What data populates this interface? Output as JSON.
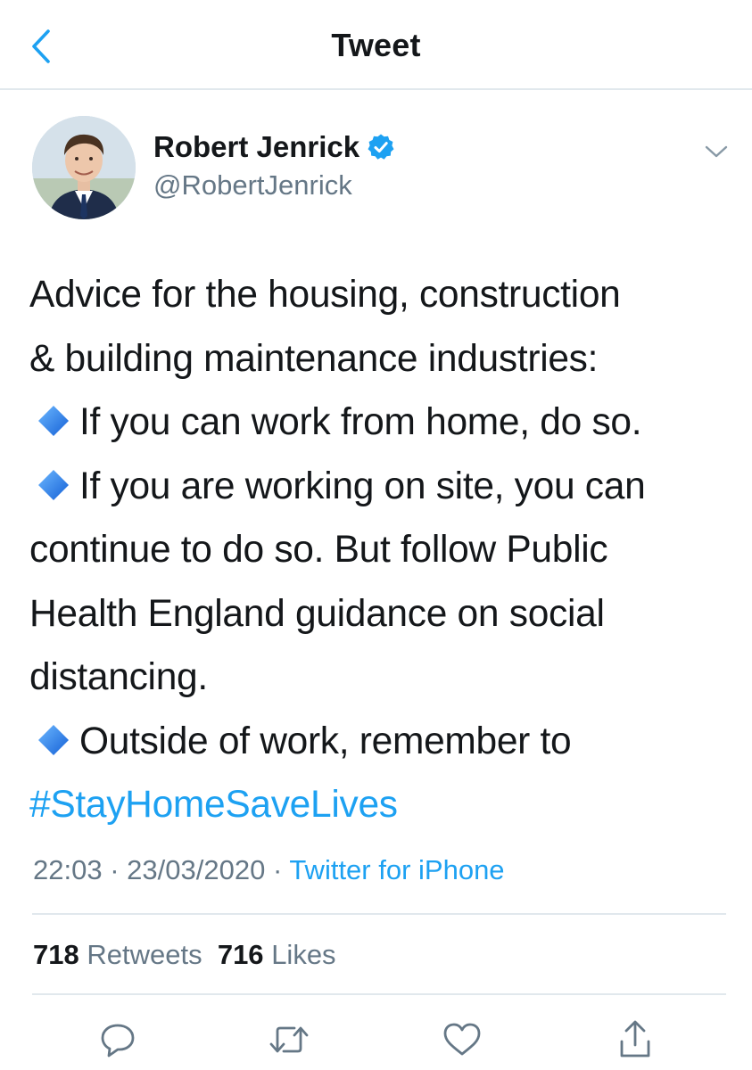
{
  "header": {
    "title": "Tweet",
    "back_icon": "chevron-left-icon"
  },
  "author": {
    "name": "Robert Jenrick",
    "handle": "@RobertJenrick",
    "verified": true,
    "more_icon": "chevron-down-icon"
  },
  "tweet": {
    "lines": [
      "Advice for the housing, construction",
      "& building maintenance industries:",
      "If you can work from home, do so.",
      "If you are working on site, you can",
      "continue to do so. But follow Public",
      "Health England guidance on social",
      "distancing.",
      "Outside of work, remember to"
    ],
    "bullet_icon": "blue-diamond-emoji",
    "hashtag": "#StayHomeSaveLives"
  },
  "meta": {
    "time": "22:03",
    "date": "23/03/2020",
    "separator": "·",
    "source": "Twitter for iPhone"
  },
  "stats": {
    "retweets_count": "718",
    "retweets_label": "Retweets",
    "likes_count": "716",
    "likes_label": "Likes"
  },
  "actions": [
    "reply-icon",
    "retweet-icon",
    "like-icon",
    "share-icon"
  ],
  "colors": {
    "accent": "#1da1f2",
    "text": "#14171a",
    "secondary": "#657786",
    "divider": "#e1e8ed"
  }
}
